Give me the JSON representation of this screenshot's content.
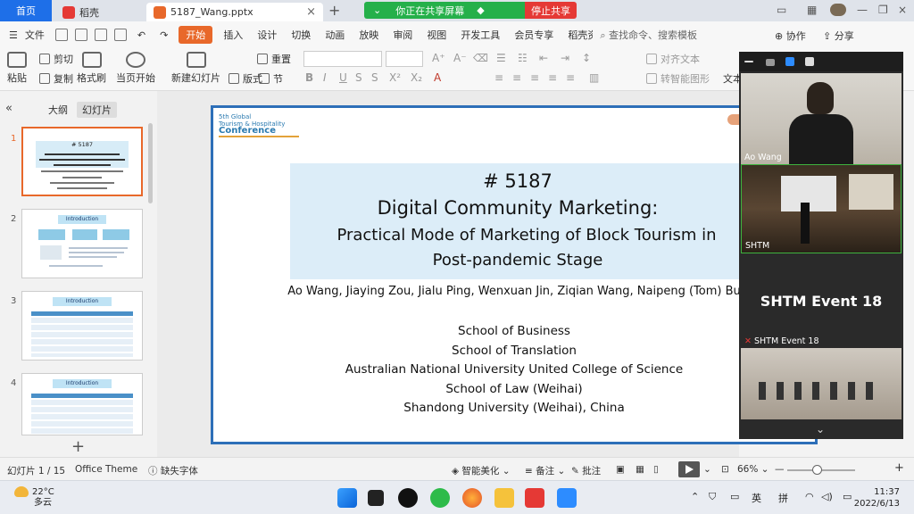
{
  "tabs": {
    "home": "首页",
    "wps": "稻壳",
    "file": "5187_Wang.pptx",
    "new_tab": "+"
  },
  "share": {
    "sharing_label": "你正在共享屏幕",
    "stop_label": "停止共享"
  },
  "menu": {
    "file": "文件",
    "start": "开始",
    "items": [
      "插入",
      "设计",
      "切换",
      "动画",
      "放映",
      "审阅",
      "视图",
      "开发工具",
      "会员专享",
      "稻壳资源"
    ],
    "search": "查找命令、搜索模板",
    "collab": "协作",
    "share": "分享"
  },
  "ribbon": {
    "cut": "剪切",
    "copy": "复制",
    "format_painter": "格式刷",
    "paste": "粘贴",
    "from_current": "当页开始",
    "new_slide": "新建幻灯片",
    "layout": "版式",
    "section": "节",
    "reset": "重置",
    "text_align": "对齐文本",
    "smart_shape": "转智能图形",
    "textbox": "文本"
  },
  "left_panel": {
    "outline_tab": "大纲",
    "slides_tab": "幻灯片",
    "numbers": [
      "1",
      "2",
      "3",
      "4"
    ],
    "thumb_titles": [
      "# 5187",
      "Introduction",
      "Introduction",
      "Introduction"
    ]
  },
  "slide": {
    "conf_line1": "5th Global",
    "conf_line2": "Tourism & Hospitality",
    "conf_line3": "Conference",
    "number": "# 5187",
    "title_line1": "Digital Community Marketing:",
    "title_line2": "Practical Mode of Marketing of Block Tourism in",
    "title_line3": "Post-pandemic Stage",
    "authors": "Ao Wang, Jiaying Zou, Jialu Ping, Wenxuan Jin, Ziqian Wang, Naipeng (Tom) Bu",
    "affiliations": [
      "School of Business",
      "School of Translation",
      "Australian National University United College of Science",
      "School of Law (Weihai)",
      "Shandong University (Weihai), China"
    ]
  },
  "meeting": {
    "tile1_name": "Ao Wang",
    "tile2_name": "SHTM",
    "tile3_title": "SHTM Event 18",
    "tile3_name": "SHTM Event 18"
  },
  "status": {
    "slide_counter": "幻灯片 1 / 15",
    "theme": "Office Theme",
    "missing_font": "缺失字体",
    "smart_beautify": "智能美化",
    "notes": "备注",
    "comments": "批注",
    "zoom": "66%"
  },
  "taskbar": {
    "temp": "22°C",
    "weather": "多云",
    "ime_lang": "英",
    "ime_mode": "拼",
    "time": "11:37",
    "date": "2022/6/13"
  },
  "colors": {
    "accent_orange": "#e8682a",
    "share_green": "#25b04a",
    "stop_red": "#e53935",
    "slide_border": "#2d6fb8",
    "title_bg": "#dcedf8"
  }
}
